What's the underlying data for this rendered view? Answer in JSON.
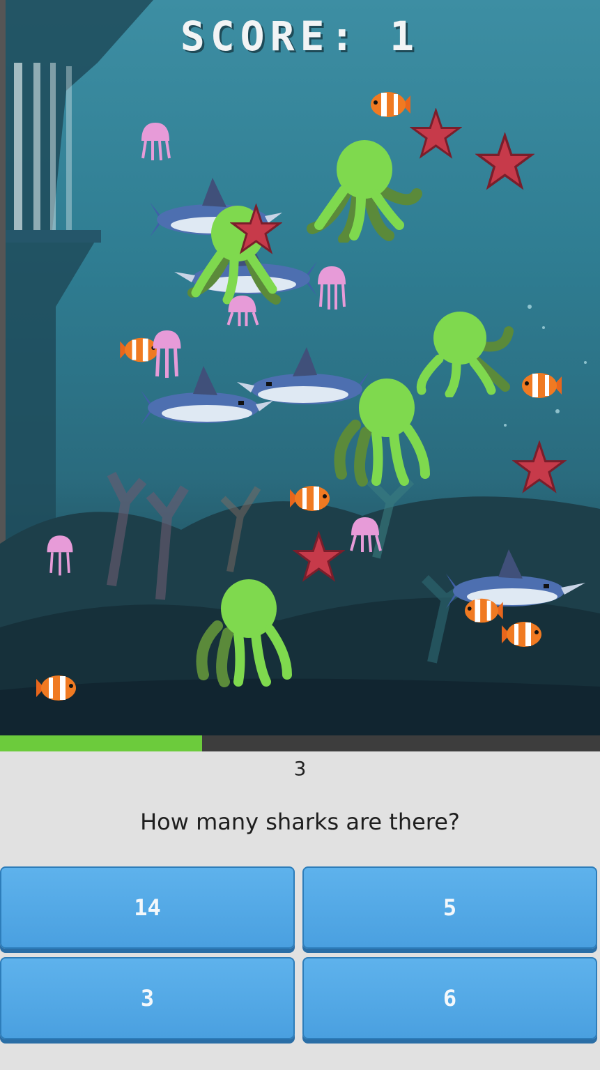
{
  "game": {
    "score_label": "SCORE: 1",
    "timer_fraction": 0.337,
    "countdown": "3",
    "question": "How many sharks are there?",
    "answers": [
      "14",
      "5",
      "3",
      "6"
    ]
  },
  "creature_icons": [
    "shark-icon",
    "octopus-icon",
    "starfish-icon",
    "clownfish-icon",
    "jellyfish-icon"
  ],
  "colors": {
    "timer_fill": "#6ccb3c",
    "timer_track": "#3d3d3d",
    "button_blue": "#4aa0e0",
    "panel_bg": "#e1e1e1"
  }
}
